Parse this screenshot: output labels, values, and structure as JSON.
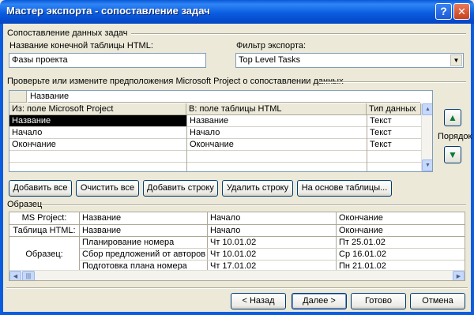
{
  "window": {
    "title": "Мастер экспорта - сопоставление задач"
  },
  "titlebar": {
    "help_glyph": "?",
    "close_glyph": "✕"
  },
  "section_task_mapping": {
    "label": "Сопоставление данных задач"
  },
  "dest_table": {
    "label": "Название конечной таблицы HTML:",
    "value": "Фазы проекта"
  },
  "filter": {
    "label": "Фильтр экспорта:",
    "value": "Top Level Tasks"
  },
  "verify_label": "Проверьте или измените предположения Microsoft Project о сопоставлении данных",
  "mapping_grid": {
    "edit_value": "Название",
    "headers": [
      "Из: поле Microsoft Project",
      "В:  поле таблицы HTML",
      "Тип данных"
    ],
    "rows": [
      [
        "Название",
        "Название",
        "Текст"
      ],
      [
        "Начало",
        "Начало",
        "Текст"
      ],
      [
        "Окончание",
        "Окончание",
        "Текст"
      ]
    ]
  },
  "order": {
    "label": "Порядок",
    "up_glyph": "▲",
    "down_glyph": "▼"
  },
  "actions": {
    "add_all": "Добавить все",
    "clear_all": "Очистить все",
    "add_row": "Добавить строку",
    "delete_row": "Удалить строку",
    "from_table": "На основе таблицы..."
  },
  "preview": {
    "label": "Образец",
    "row_ms_project": "MS Project:",
    "row_html_table": "Таблица HTML:",
    "row_sample": "Образец:",
    "ms_project_cols": [
      "Название",
      "Начало",
      "Окончание"
    ],
    "html_cols": [
      "Название",
      "Начало",
      "Окончание"
    ],
    "sample_rows": [
      [
        "Планирование номера",
        "Чт 10.01.02",
        "Пт 25.01.02"
      ],
      [
        "Сбор предложений от авторов",
        "Чт 10.01.02",
        "Ср 16.01.02"
      ],
      [
        "Подготовка плана номера",
        "Чт 17.01.02",
        "Пн 21.01.02"
      ]
    ]
  },
  "footer": {
    "back": "< Назад",
    "next": "Далее >",
    "finish": "Готово",
    "cancel": "Отмена"
  }
}
